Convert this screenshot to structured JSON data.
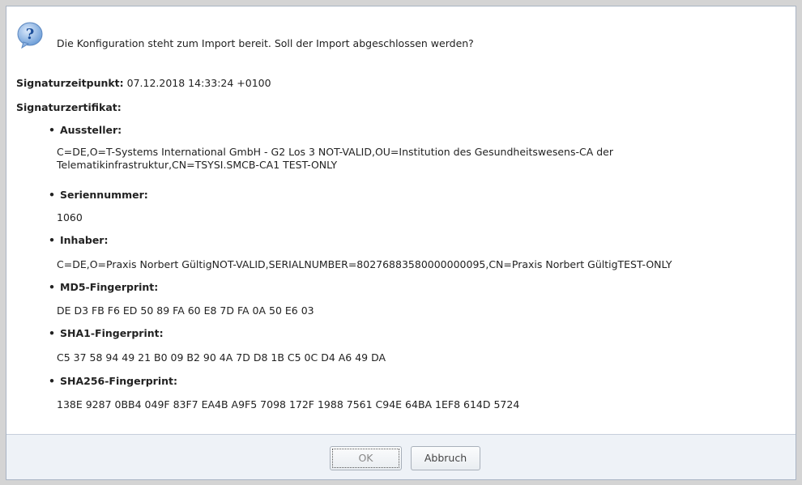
{
  "dialog": {
    "question": "Die Konfiguration steht zum Import bereit. Soll der Import abgeschlossen werden?",
    "sig_time_label": "Signaturzeitpunkt:",
    "sig_time_value": " 07.12.2018 14:33:24 +0100",
    "sig_cert_label": "Signaturzertifikat:",
    "items": [
      {
        "label": "Aussteller:",
        "value": "C=DE,O=T-Systems International GmbH - G2 Los 3 NOT-VALID,OU=Institution des Gesundheitswesens-CA der Telematikinfrastruktur,CN=TSYSI.SMCB-CA1 TEST-ONLY"
      },
      {
        "label": "Seriennummer:",
        "value": "1060"
      },
      {
        "label": "Inhaber:",
        "value": "C=DE,O=Praxis Norbert GültigNOT-VALID,SERIALNUMBER=80276883580000000095,CN=Praxis Norbert GültigTEST-ONLY"
      },
      {
        "label": "MD5-Fingerprint:",
        "value": "DE D3 FB F6 ED 50 89 FA 60 E8 7D FA 0A 50 E6 03"
      },
      {
        "label": "SHA1-Fingerprint:",
        "value": "C5 37 58 94 49 21 B0 09 B2 90 4A 7D D8 1B C5 0C D4 A6 49 DA"
      },
      {
        "label": "SHA256-Fingerprint:",
        "value": "138E 9287 0BB4 049F 83F7 EA4B A9F5 7098 172F 1988 7561 C94E 64BA 1EF8 614D 5724"
      }
    ]
  },
  "buttons": {
    "ok": "OK",
    "cancel": "Abbruch"
  },
  "icons": {
    "question": "question-icon"
  },
  "colors": {
    "icon_blue": "#3a78c9",
    "footer_bg": "#eef2f7"
  }
}
